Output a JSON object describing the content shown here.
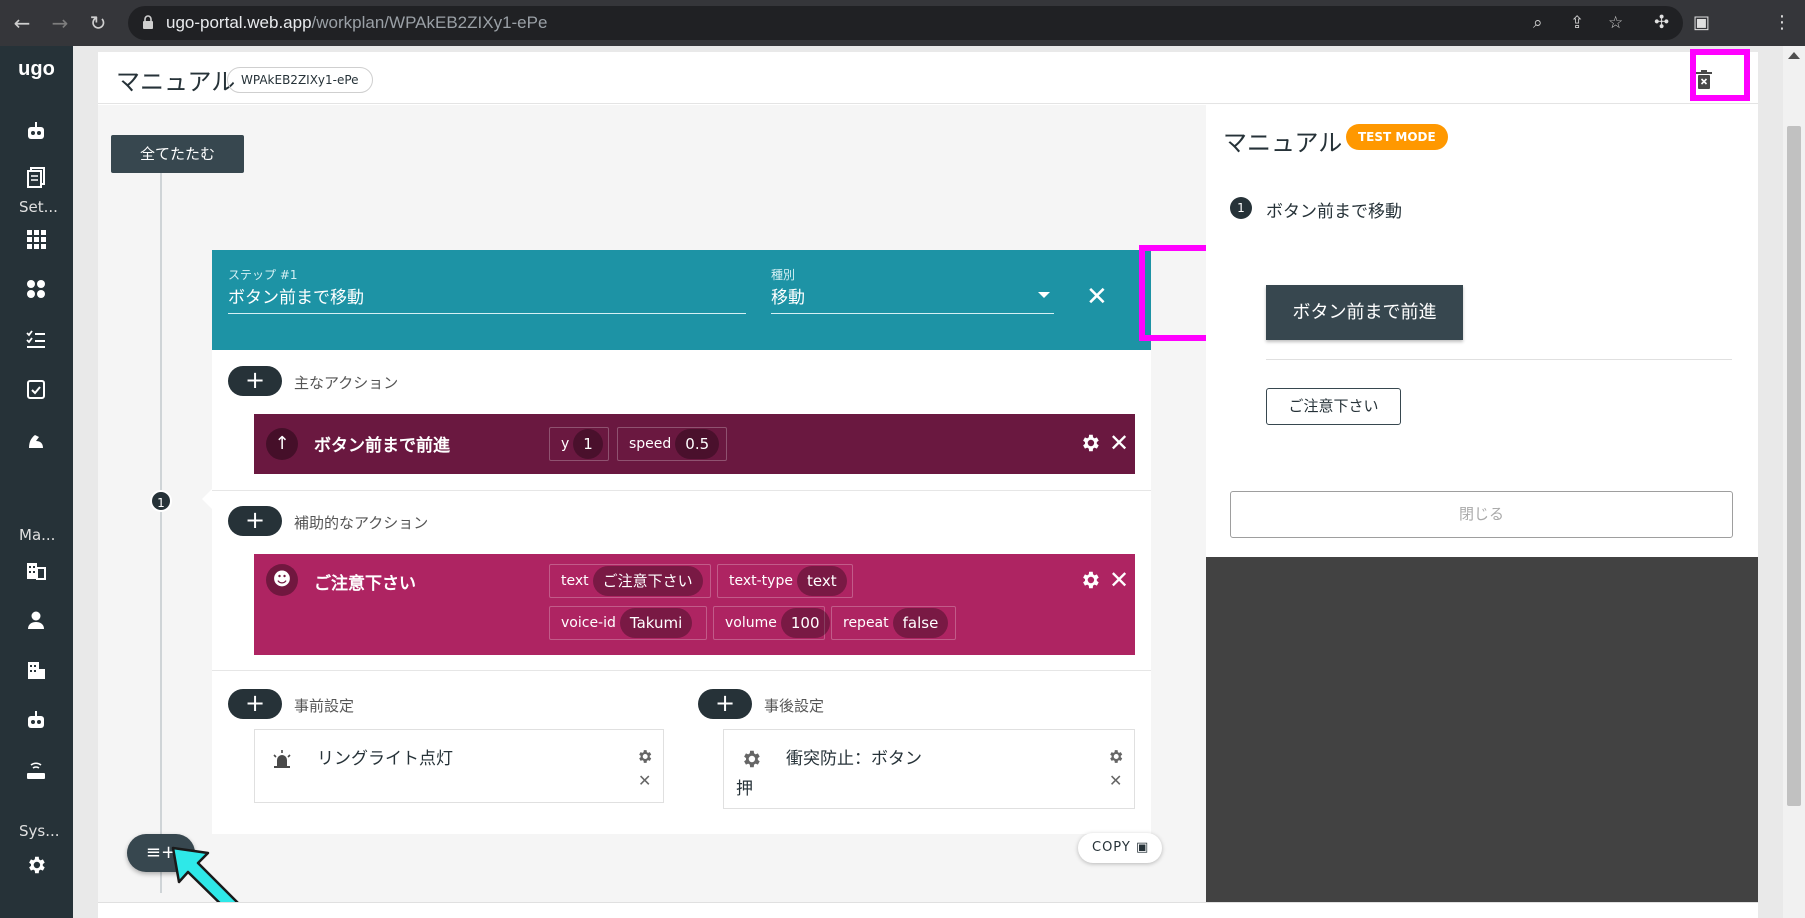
{
  "browser": {
    "url_host": "ugo-portal.web.app",
    "url_path": "/workplan/WPAkEB2ZIXy1-ePe",
    "icons": [
      "back-icon",
      "forward-icon",
      "reload-icon",
      "lock-icon",
      "zoom-icon",
      "share-icon",
      "star-icon",
      "extensions-icon",
      "sidepanel-icon",
      "menu-icon"
    ]
  },
  "sidebar": {
    "logo": "ugo",
    "sections": [
      "Set...",
      "Ma...",
      "Sys..."
    ]
  },
  "header": {
    "title": "マニュアル",
    "workplan_id": "WPAkEB2ZIXy1-ePe"
  },
  "editor": {
    "collapse_all": "全てたたむ",
    "step_number": "1",
    "step": {
      "label_step": "ステップ #1",
      "name": "ボタン前まで移動",
      "label_type": "種別",
      "type": "移動"
    },
    "main_actions_label": "主なアクション",
    "main_action": {
      "title": "ボタン前まで前進",
      "params": [
        {
          "key": "y",
          "value": "1"
        },
        {
          "key": "speed",
          "value": "0.5"
        }
      ]
    },
    "sub_actions_label": "補助的なアクション",
    "sub_action": {
      "title": "ご注意下さい",
      "params": [
        {
          "key": "text",
          "value": "ご注意下さい"
        },
        {
          "key": "text-type",
          "value": "text"
        },
        {
          "key": "voice-id",
          "value": "Takumi"
        },
        {
          "key": "volume",
          "value": "100"
        },
        {
          "key": "repeat",
          "value": "false"
        }
      ]
    },
    "pre_label": "事前設定",
    "pre_item": "リングライト点灯",
    "post_label": "事後設定",
    "post_item_line1": "衝突防止：ボタン",
    "post_item_line2": "押",
    "copy": "COPY"
  },
  "preview": {
    "title": "マニュアル",
    "badge": "TEST MODE",
    "step_number": "1",
    "step_name": "ボタン前まで移動",
    "action_button": "ボタン前まで前進",
    "sub_button": "ご注意下さい",
    "close": "閉じる"
  },
  "colors": {
    "step_header": "#1d93a5",
    "main_action": "#6a1840",
    "sub_action": "#ae2462",
    "highlight": "#ff00ff",
    "arrow": "#2ee8e8",
    "badge": "#ff9800"
  }
}
